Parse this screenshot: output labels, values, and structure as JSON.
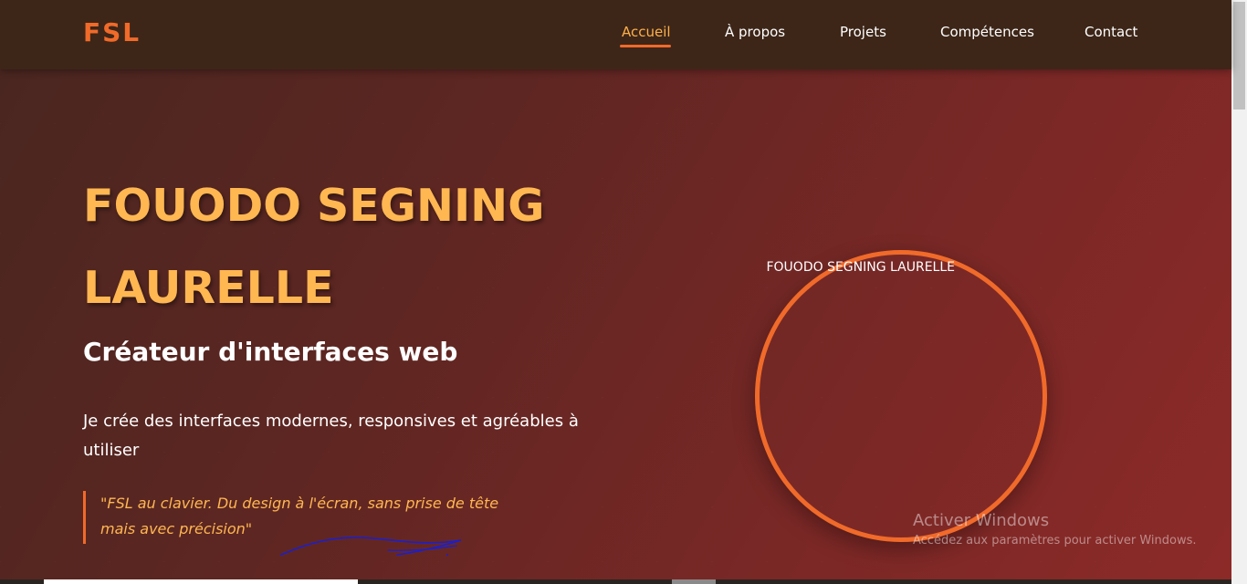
{
  "header": {
    "logo": "FSL",
    "nav": [
      {
        "label": "Accueil",
        "active": true
      },
      {
        "label": "À propos"
      },
      {
        "label": "Projets"
      },
      {
        "label": "Compétences"
      },
      {
        "label": "Contact"
      }
    ]
  },
  "hero": {
    "title": "FOUODO SEGNING LAURELLE",
    "subtitle": "Créateur d'interfaces web",
    "description": "Je crée des interfaces modernes, responsives et agréables à utiliser",
    "quote": "\"FSL au clavier. Du design à l'écran, sans prise de tête mais avec précision\"",
    "profile_image_alt": "FOUODO SEGNING LAURELLE"
  },
  "watermark": {
    "title": "Activer Windows",
    "subtitle": "Accédez aux paramètres pour activer Windows."
  },
  "colors": {
    "accent": "#f06a2a",
    "title": "#ffb752",
    "nav_bg": "#3d2618",
    "hero_start": "#4a2620",
    "hero_end": "#8c2a28"
  }
}
